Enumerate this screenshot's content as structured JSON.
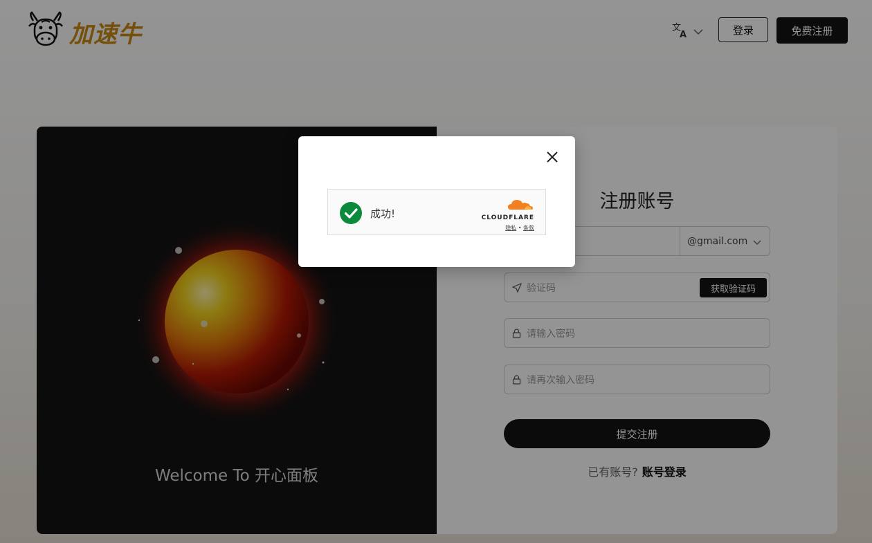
{
  "header": {
    "logo_text": "加速牛",
    "login_label": "登录",
    "signup_label": "免费注册"
  },
  "left": {
    "welcome_text": "Welcome To 开心面板"
  },
  "form": {
    "title": "注册账号",
    "email_suffix": "@gmail.com",
    "code_placeholder": "验证码",
    "get_code_label": "获取验证码",
    "password_placeholder": "请输入密码",
    "password_confirm_placeholder": "请再次输入密码",
    "submit_label": "提交注册",
    "have_account_text": "已有账号?",
    "login_link_label": "账号登录"
  },
  "modal": {
    "status_text": "成功!",
    "brand_name": "CLOUDFLARE",
    "privacy_label": "隐私",
    "separator": "•",
    "terms_label": "条款"
  },
  "colors": {
    "brand_gold": "#c98a14",
    "dark": "#141414",
    "success_green": "#0a8a3a",
    "cloudflare_orange": "#f38020"
  }
}
